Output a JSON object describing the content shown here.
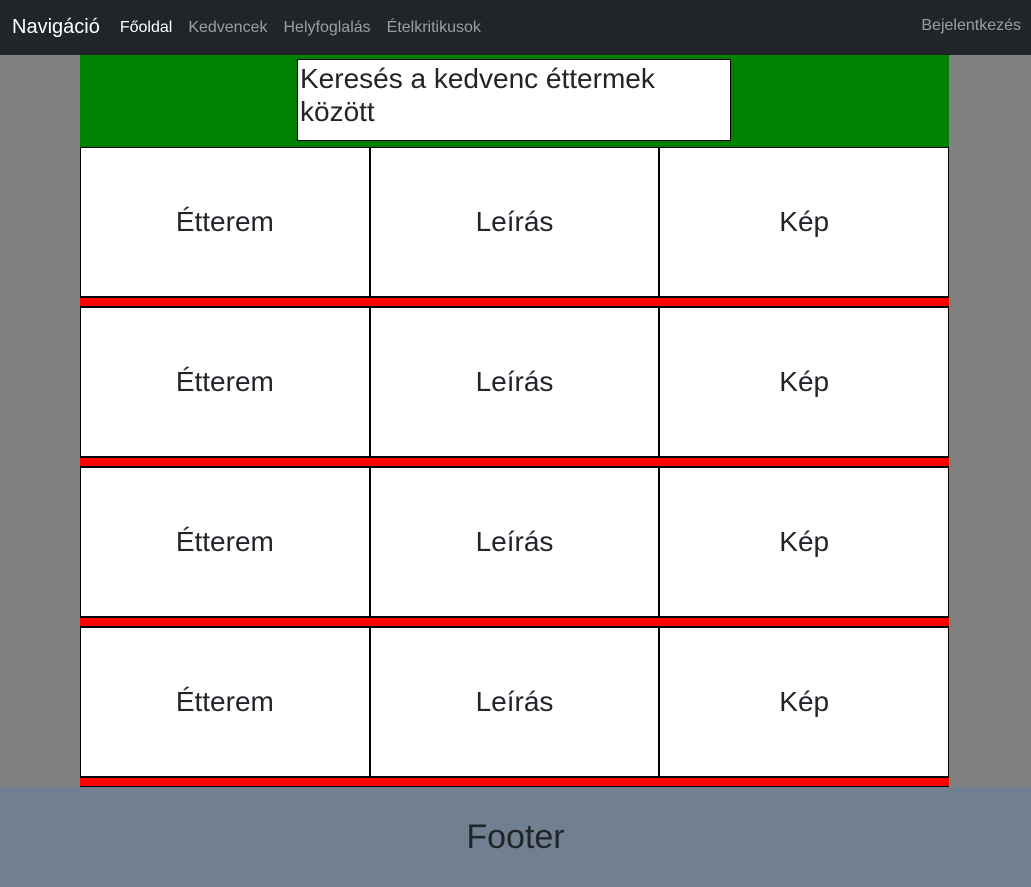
{
  "navbar": {
    "brand": "Navigáció",
    "links": [
      "Főoldal",
      "Kedvencek",
      "Helyfoglalás",
      "Ételkritikusok"
    ],
    "login": "Bejelentkezés"
  },
  "search": {
    "placeholder": "Keresés a kedvenc éttermek között"
  },
  "rows": [
    {
      "restaurant": "Étterem",
      "description": "Leírás",
      "image": "Kép"
    },
    {
      "restaurant": "Étterem",
      "description": "Leírás",
      "image": "Kép"
    },
    {
      "restaurant": "Étterem",
      "description": "Leírás",
      "image": "Kép"
    },
    {
      "restaurant": "Étterem",
      "description": "Leírás",
      "image": "Kép"
    }
  ],
  "footer": {
    "text": "Footer"
  },
  "colors": {
    "navbar": "#212529",
    "header": "#008000",
    "separator": "#ff0000",
    "page_bg": "#808080",
    "footer": "#708090"
  }
}
